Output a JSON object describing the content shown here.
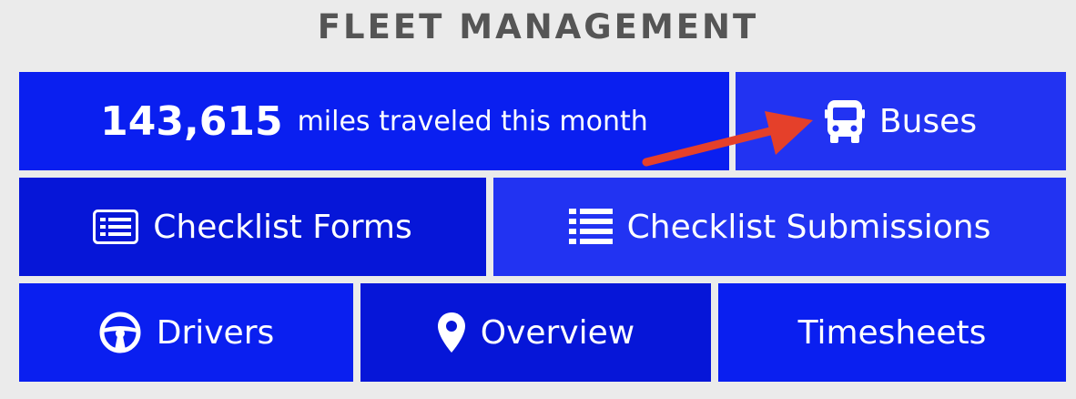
{
  "header": {
    "title": "FLEET MANAGEMENT"
  },
  "stat": {
    "value": "143,615",
    "label": "miles traveled this month"
  },
  "tiles": {
    "buses": {
      "label": "Buses",
      "icon": "bus-icon"
    },
    "checklist_forms": {
      "label": "Checklist Forms",
      "icon": "form-icon"
    },
    "checklist_submissions": {
      "label": "Checklist Submissions",
      "icon": "list-icon"
    },
    "drivers": {
      "label": "Drivers",
      "icon": "steering-wheel-icon"
    },
    "overview": {
      "label": "Overview",
      "icon": "map-pin-icon"
    },
    "timesheets": {
      "label": "Timesheets"
    }
  },
  "colors": {
    "background": "#ebebeb",
    "title": "#555555",
    "tile_blue": "#0a1ff0",
    "tile_light": "#2233f2",
    "tile_dark": "#0616d8",
    "arrow": "#e5402a"
  }
}
